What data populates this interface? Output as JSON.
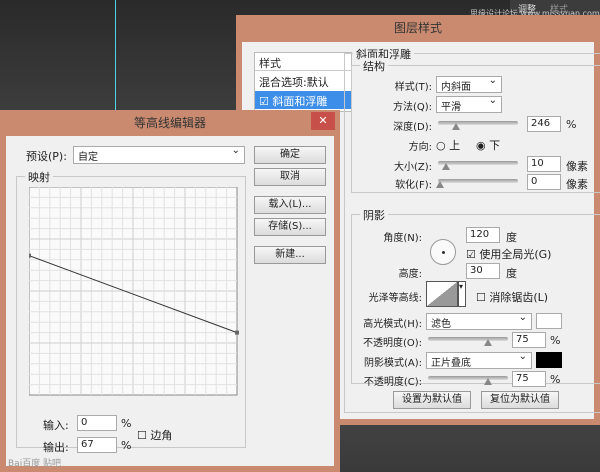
{
  "top_panel": {
    "tab1": "调整",
    "tab2": "样式",
    "watermark": "思缘设计论坛 www.missyuan.com"
  },
  "layer_style": {
    "title": "图层样式",
    "list": [
      "样式",
      "混合选项:默认",
      "斜面和浮雕"
    ],
    "bevel": {
      "group": "斜面和浮雕",
      "structure": "结构",
      "style_label": "样式(T):",
      "style_value": "内斜面",
      "technique_label": "方法(Q):",
      "technique_value": "平滑",
      "depth_label": "深度(D):",
      "depth_value": "246",
      "pct": "%",
      "direction_label": "方向:",
      "dir_up": "上",
      "dir_down": "下",
      "direction_selected": "下",
      "size_label": "大小(Z):",
      "size_value": "10",
      "px": "像素",
      "soften_label": "软化(F):",
      "soften_value": "0"
    },
    "shading": {
      "group": "阴影",
      "angle_label": "角度(N):",
      "angle_value": "120",
      "deg": "度",
      "global_light": "使用全局光(G)",
      "global_light_checked": true,
      "altitude_label": "高度:",
      "altitude_value": "30",
      "gloss_label": "光泽等高线:",
      "antialias": "消除锯齿(L)",
      "antialias_checked": false,
      "highlight_label": "高光模式(H):",
      "highlight_value": "滤色",
      "highlight_color": "#ffffff",
      "opacity1_label": "不透明度(O):",
      "opacity1_value": "75",
      "shadow_label": "阴影模式(A):",
      "shadow_value": "正片叠底",
      "shadow_color": "#000000",
      "opacity2_label": "不透明度(C):",
      "opacity2_value": "75"
    },
    "btn_default": "设置为默认值",
    "btn_reset": "复位为默认值"
  },
  "contour_editor": {
    "title": "等高线编辑器",
    "preset_label": "预设(P):",
    "preset_value": "自定",
    "mapping": "映射",
    "ok": "确定",
    "cancel": "取消",
    "load": "载入(L)...",
    "save": "存储(S)...",
    "new": "新建...",
    "input_label": "输入:",
    "input_value": "0",
    "output_label": "输出:",
    "output_value": "67",
    "pct": "%",
    "corner": "边角",
    "corner_checked": false,
    "curve_points": [
      {
        "input": 0,
        "output": 67
      },
      {
        "input": 100,
        "output": 30
      }
    ]
  },
  "logo_text": "Bai百度 贴吧"
}
